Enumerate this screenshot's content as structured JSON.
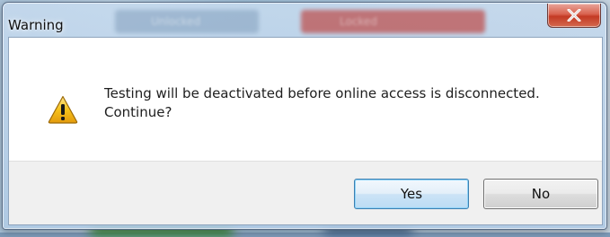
{
  "window": {
    "title": "Warning",
    "close_icon": "close-icon"
  },
  "background_tabs": {
    "unlocked_label": "Unlocked",
    "locked_label": "Locked"
  },
  "dialog": {
    "icon": "warning-icon",
    "message_line1": "Testing will be deactivated before online access is disconnected.",
    "message_line2": "Continue?"
  },
  "buttons": {
    "yes_label": "Yes",
    "no_label": "No"
  },
  "colors": {
    "close_button": "#c33a24",
    "default_button_border": "#3c7fb1",
    "warning_yellow": "#f7c21b"
  }
}
